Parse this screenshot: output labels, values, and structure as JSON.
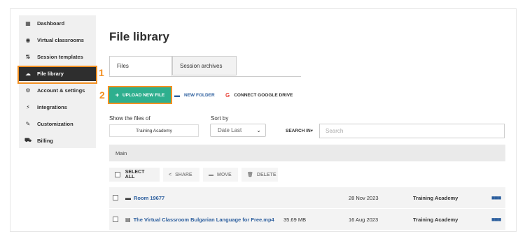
{
  "sidebar": {
    "items": [
      {
        "label": "Dashboard",
        "icon": "grid-icon"
      },
      {
        "label": "Virtual classrooms",
        "icon": "target-icon"
      },
      {
        "label": "Session templates",
        "icon": "template-icon"
      },
      {
        "label": "File library",
        "icon": "cloud-icon"
      },
      {
        "label": "Account & settings",
        "icon": "gear-icon"
      },
      {
        "label": "Integrations",
        "icon": "plug-icon"
      },
      {
        "label": "Customization",
        "icon": "wrench-icon"
      },
      {
        "label": "Billing",
        "icon": "cart-icon"
      }
    ]
  },
  "annotations": {
    "step1": "1",
    "step2": "2",
    "color": "#f39022"
  },
  "page": {
    "title": "File library"
  },
  "tabs": [
    {
      "label": "Files"
    },
    {
      "label": "Session archives"
    }
  ],
  "toolbar": {
    "upload_label": "UPLOAD NEW FILE",
    "new_folder_label": "NEW FOLDER",
    "google_drive_label": "CONNECT GOOGLE DRIVE",
    "accent": "#2eaf8e"
  },
  "filters": {
    "show_label": "Show the files of",
    "show_value": "Training Academy",
    "sort_label": "Sort by",
    "sort_value": "Date Last",
    "search_in_label": "SEARCH IN▾",
    "search_placeholder": "Search"
  },
  "folder_bar": {
    "label": "Main"
  },
  "bulk": {
    "select_all": "SELECT ALL",
    "share": "SHARE",
    "move": "MOVE",
    "delete": "DELETE"
  },
  "files": [
    {
      "name": "Room 19677",
      "type": "folder",
      "size": "",
      "date": "28 Nov 2023",
      "owner": "Training Academy"
    },
    {
      "name": "The Virtual Classroom Bulgarian Language for Free.mp4",
      "type": "file",
      "size": "35.69 MB",
      "date": "16 Aug 2023",
      "owner": "Training Academy"
    }
  ]
}
